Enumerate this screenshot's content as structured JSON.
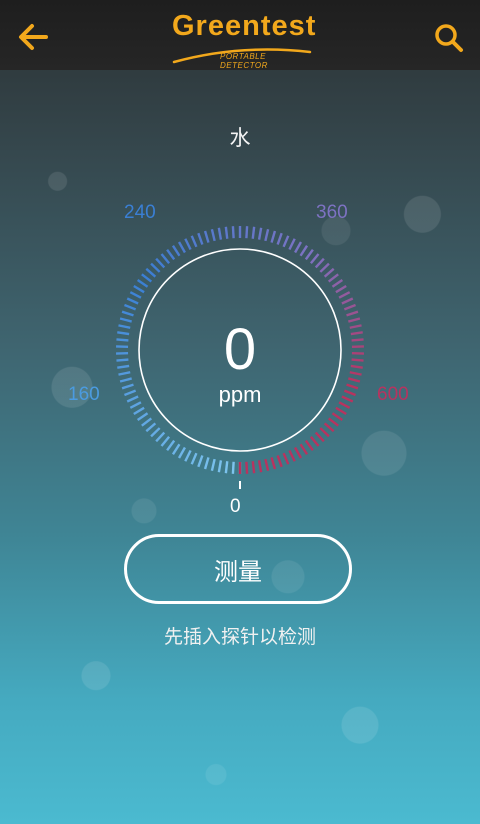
{
  "header": {
    "brand": "Greentest",
    "brand_subtitle": "PORTABLE DETECTOR",
    "accent_color": "#f2a81c",
    "back_icon": "arrow-left-icon",
    "search_icon": "search-icon"
  },
  "sample": {
    "label": "水"
  },
  "gauge": {
    "reading": "0",
    "unit": "ppm",
    "scale_labels": {
      "zero": "0",
      "low": "160",
      "mid_low": "240",
      "mid_high": "360",
      "high": "600"
    },
    "colors": {
      "low": "#7fc6ee",
      "mid": "#3a7fd4",
      "upper": "#7d72c2",
      "high": "#b8335f"
    }
  },
  "actions": {
    "measure_label": "测量"
  },
  "hint": {
    "text": "先插入探针以检测"
  }
}
